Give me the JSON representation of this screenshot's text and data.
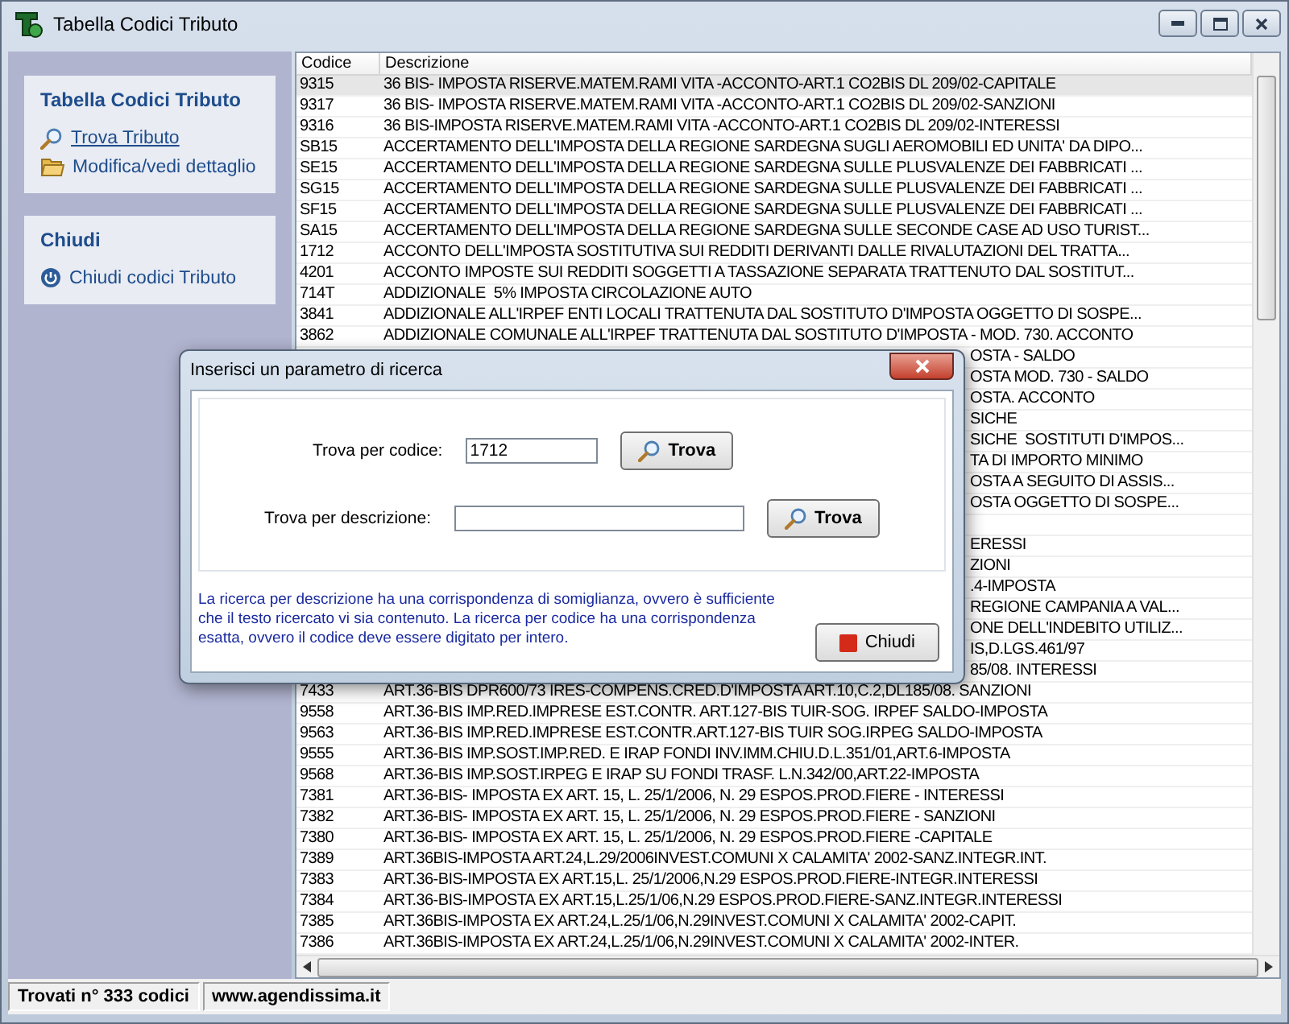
{
  "window": {
    "title": "Tabella Codici Tributo"
  },
  "sidebar": {
    "groups": [
      {
        "title": "Tabella Codici Tributo",
        "items": [
          {
            "label": "Trova Tributo",
            "kind": "search",
            "hovered": true
          },
          {
            "label": "Modifica/vedi dettaglio",
            "kind": "folder",
            "hovered": false
          }
        ]
      },
      {
        "title": "Chiudi",
        "items": [
          {
            "label": "Chiudi codici Tributo",
            "kind": "power",
            "hovered": false
          }
        ]
      }
    ]
  },
  "table": {
    "columns": [
      "Codice",
      "Descrizione"
    ],
    "rows": [
      {
        "kind": "row",
        "selected": true,
        "code": "9315",
        "description": "36 BIS- IMPOSTA RISERVE.MATEM.RAMI VITA -ACCONTO-ART.1 CO2BIS DL 209/02-CAPITALE"
      },
      {
        "kind": "row",
        "selected": false,
        "code": "9317",
        "description": "36 BIS- IMPOSTA RISERVE.MATEM.RAMI VITA -ACCONTO-ART.1 CO2BIS DL 209/02-SANZIONI"
      },
      {
        "kind": "row",
        "selected": false,
        "code": "9316",
        "description": "36 BIS-IMPOSTA RISERVE.MATEM.RAMI VITA -ACCONTO-ART.1 CO2BIS DL 209/02-INTERESSI"
      },
      {
        "kind": "row",
        "selected": false,
        "code": "SB15",
        "description": "ACCERTAMENTO DELL'IMPOSTA DELLA REGIONE SARDEGNA SUGLI AEROMOBILI ED UNITA' DA DIPO..."
      },
      {
        "kind": "row",
        "selected": false,
        "code": "SE15",
        "description": "ACCERTAMENTO DELL'IMPOSTA DELLA REGIONE SARDEGNA SULLE PLUSVALENZE DEI FABBRICATI ..."
      },
      {
        "kind": "row",
        "selected": false,
        "code": "SG15",
        "description": "ACCERTAMENTO DELL'IMPOSTA DELLA REGIONE SARDEGNA SULLE PLUSVALENZE DEI FABBRICATI ..."
      },
      {
        "kind": "row",
        "selected": false,
        "code": "SF15",
        "description": "ACCERTAMENTO DELL'IMPOSTA DELLA REGIONE SARDEGNA SULLE PLUSVALENZE DEI FABBRICATI ..."
      },
      {
        "kind": "row",
        "selected": false,
        "code": "SA15",
        "description": "ACCERTAMENTO DELL'IMPOSTA DELLA REGIONE SARDEGNA SULLE SECONDE CASE AD USO TURIST..."
      },
      {
        "kind": "row",
        "selected": false,
        "code": "1712",
        "description": "ACCONTO DELL'IMPOSTA SOSTITUTIVA SUI REDDITI DERIVANTI DALLE RIVALUTAZIONI DEL TRATTA..."
      },
      {
        "kind": "row",
        "selected": false,
        "code": "4201",
        "description": "ACCONTO IMPOSTE SUI REDDITI SOGGETTI A TASSAZIONE SEPARATA TRATTENUTO DAL SOSTITUT..."
      },
      {
        "kind": "row",
        "selected": false,
        "code": "714T",
        "description": "ADDIZIONALE  5% IMPOSTA CIRCOLAZIONE AUTO"
      },
      {
        "kind": "row",
        "selected": false,
        "code": "3841",
        "description": "ADDIZIONALE ALL'IRPEF ENTI LOCALI TRATTENUTA DAL SOSTITUTO D'IMPOSTA OGGETTO DI SOSPE..."
      },
      {
        "kind": "row",
        "selected": false,
        "code": "3862",
        "description": "ADDIZIONALE COMUNALE ALL'IRPEF TRATTENUTA DAL SOSTITUTO D'IMPOSTA - MOD. 730. ACCONTO"
      },
      {
        "kind": "covered",
        "selected": false,
        "description": "OSTA - SALDO"
      },
      {
        "kind": "covered",
        "selected": false,
        "description": "OSTA MOD. 730 - SALDO"
      },
      {
        "kind": "covered",
        "selected": false,
        "description": "OSTA. ACCONTO"
      },
      {
        "kind": "covered",
        "selected": false,
        "description": "SICHE"
      },
      {
        "kind": "covered",
        "selected": false,
        "description": "SICHE  SOSTITUTI D'IMPOS..."
      },
      {
        "kind": "covered",
        "selected": false,
        "description": "TA DI IMPORTO MINIMO"
      },
      {
        "kind": "covered",
        "selected": false,
        "description": "OSTA A SEGUITO DI ASSIS..."
      },
      {
        "kind": "covered",
        "selected": false,
        "description": "OSTA OGGETTO DI SOSPE..."
      },
      {
        "kind": "covered",
        "selected": false
      },
      {
        "kind": "covered",
        "selected": false,
        "description": "ERESSI"
      },
      {
        "kind": "covered",
        "selected": false,
        "description": "ZIONI"
      },
      {
        "kind": "covered",
        "selected": false,
        "description": ".4-IMPOSTA"
      },
      {
        "kind": "covered",
        "selected": false,
        "description": "REGIONE CAMPANIA A VAL..."
      },
      {
        "kind": "covered",
        "selected": false,
        "description": "ONE DELL'INDEBITO UTILIZ..."
      },
      {
        "kind": "covered",
        "selected": false,
        "description": "IS,D.LGS.461/97"
      },
      {
        "kind": "covered",
        "selected": false,
        "description": "85/08. INTERESSI"
      },
      {
        "kind": "row",
        "selected": false,
        "code": "7433",
        "description": "ART.36-BIS DPR600/73 IRES-COMPENS.CRED.D'IMPOSTA ART.10,C.2,DL185/08. SANZIONI"
      },
      {
        "kind": "row",
        "selected": false,
        "code": "9558",
        "description": "ART.36-BIS IMP.RED.IMPRESE EST.CONTR. ART.127-BIS TUIR-SOG. IRPEF SALDO-IMPOSTA"
      },
      {
        "kind": "row",
        "selected": false,
        "code": "9563",
        "description": "ART.36-BIS IMP.RED.IMPRESE EST.CONTR.ART.127-BIS TUIR SOG.IRPEG SALDO-IMPOSTA"
      },
      {
        "kind": "row",
        "selected": false,
        "code": "9555",
        "description": "ART.36-BIS IMP.SOST.IMP.RED. E IRAP FONDI INV.IMM.CHIU.D.L.351/01,ART.6-IMPOSTA"
      },
      {
        "kind": "row",
        "selected": false,
        "code": "9568",
        "description": "ART.36-BIS IMP.SOST.IRPEG E IRAP SU FONDI TRASF. L.N.342/00,ART.22-IMPOSTA"
      },
      {
        "kind": "row",
        "selected": false,
        "code": "7381",
        "description": "ART.36-BIS- IMPOSTA EX ART. 15, L. 25/1/2006, N. 29 ESPOS.PROD.FIERE - INTERESSI"
      },
      {
        "kind": "row",
        "selected": false,
        "code": "7382",
        "description": "ART.36-BIS- IMPOSTA EX ART. 15, L. 25/1/2006, N. 29 ESPOS.PROD.FIERE - SANZIONI"
      },
      {
        "kind": "row",
        "selected": false,
        "code": "7380",
        "description": "ART.36-BIS- IMPOSTA EX ART. 15, L. 25/1/2006, N. 29 ESPOS.PROD.FIERE -CAPITALE"
      },
      {
        "kind": "row",
        "selected": false,
        "code": "7389",
        "description": "ART.36BIS-IMPOSTA ART.24,L.29/2006INVEST.COMUNI X CALAMITA' 2002-SANZ.INTEGR.INT."
      },
      {
        "kind": "row",
        "selected": false,
        "code": "7383",
        "description": "ART.36-BIS-IMPOSTA EX ART.15,L. 25/1/2006,N.29 ESPOS.PROD.FIERE-INTEGR.INTERESSI"
      },
      {
        "kind": "row",
        "selected": false,
        "code": "7384",
        "description": "ART.36-BIS-IMPOSTA EX ART.15,L.25/1/06,N.29 ESPOS.PROD.FIERE-SANZ.INTEGR.INTERESSI"
      },
      {
        "kind": "row",
        "selected": false,
        "code": "7385",
        "description": "ART.36BIS-IMPOSTA EX ART.24,L.25/1/06,N.29INVEST.COMUNI X CALAMITA' 2002-CAPIT."
      },
      {
        "kind": "row",
        "selected": false,
        "code": "7386",
        "description": "ART.36BIS-IMPOSTA EX ART.24,L.25/1/06,N.29INVEST.COMUNI X CALAMITA' 2002-INTER."
      }
    ]
  },
  "status_bar": [
    "Trovati n° 333 codici",
    "www.agendissima.it"
  ],
  "dialog": {
    "title": "Inserisci un parametro di ricerca",
    "fields": [
      {
        "label": "Trova per codice:",
        "value": "1712",
        "button": "Trova"
      },
      {
        "label": "Trova per descrizione:",
        "button": "Trova"
      }
    ],
    "note": "La ricerca per descrizione ha una corrispondenza di somiglianza, ovvero è sufficiente che il testo ricercato vi sia contenuto. La ricerca per codice ha una corrispondenza esatta, ovvero il codice deve essere digitato per intero.",
    "close_button": "Chiudi"
  }
}
